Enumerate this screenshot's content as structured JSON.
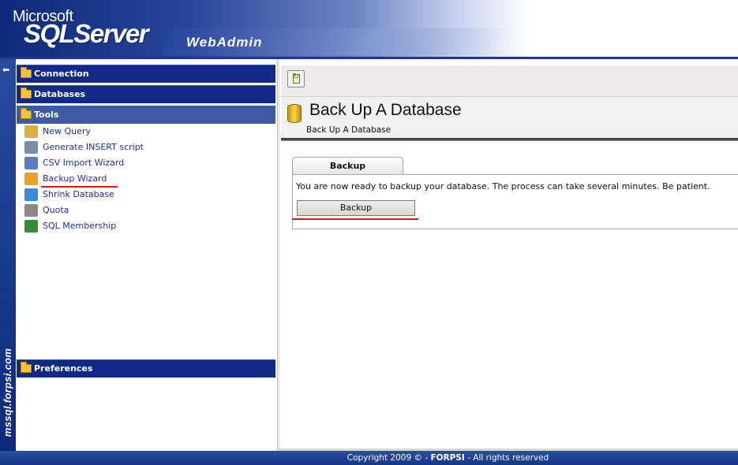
{
  "brand": {
    "microsoft": "Microsoft",
    "sqlserver": "SQLServer",
    "webadmin": "WebAdmin"
  },
  "vertical_text": "mssql.forpsi.com",
  "sidebar": {
    "sections": [
      {
        "label": "Connection"
      },
      {
        "label": "Databases"
      },
      {
        "label": "Tools"
      },
      {
        "label": "Preferences"
      }
    ],
    "tools": [
      {
        "label": "New Query",
        "icon": "new-query-icon",
        "color": "#d7b13a"
      },
      {
        "label": "Generate INSERT script",
        "icon": "insert-script-icon",
        "color": "#7b8ea8"
      },
      {
        "label": "CSV Import Wizard",
        "icon": "csv-import-icon",
        "color": "#5a7fc0"
      },
      {
        "label": "Backup Wizard",
        "icon": "backup-wizard-icon",
        "color": "#e6a52a"
      },
      {
        "label": "Shrink Database",
        "icon": "shrink-database-icon",
        "color": "#3b8ad8"
      },
      {
        "label": "Quota",
        "icon": "quota-icon",
        "color": "#8a8a8a"
      },
      {
        "label": "SQL Membership",
        "icon": "sql-membership-icon",
        "color": "#3a8a3a"
      }
    ]
  },
  "content": {
    "title": "Back Up A Database",
    "breadcrumb": "Back Up A Database",
    "tab_label": "Backup",
    "message": "You are now ready to backup your database. The process can take several minutes. Be patient.",
    "backup_button": "Backup"
  },
  "footer": {
    "prefix": "Copyright 2009 © - ",
    "company": "FORPSI",
    "suffix": " - All rights reserved"
  },
  "colors": {
    "header_blue": "#122a86",
    "link": "#1f2fa8",
    "highlight": "#d21a1a"
  }
}
